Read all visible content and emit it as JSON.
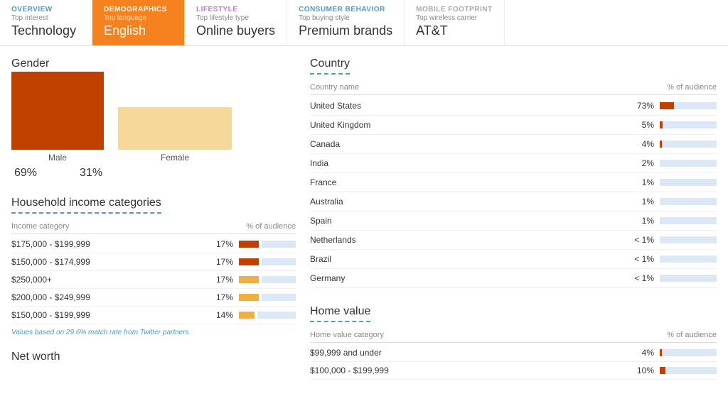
{
  "nav": {
    "tabs": [
      {
        "id": "overview",
        "label": "OVERVIEW",
        "subtitle": "Top interest",
        "value": "Technology",
        "active": false,
        "class": "overview"
      },
      {
        "id": "demographics",
        "label": "DEMOGRAPHICS",
        "subtitle": "Top language",
        "value": "English",
        "active": true,
        "class": "active"
      },
      {
        "id": "lifestyle",
        "label": "LIFESTYLE",
        "subtitle": "Top lifestyle type",
        "value": "Online buyers",
        "active": false,
        "class": "lifestyle"
      },
      {
        "id": "consumer",
        "label": "CONSUMER BEHAVIOR",
        "subtitle": "Top buying style",
        "value": "Premium brands",
        "active": false,
        "class": "consumer"
      },
      {
        "id": "mobile",
        "label": "MOBILE FOOTPRINT",
        "subtitle": "Top wireless carrier",
        "value": "AT&T",
        "active": false,
        "class": "mobile"
      }
    ]
  },
  "gender": {
    "title": "Gender",
    "male": {
      "label": "Male",
      "pct": "69%",
      "height": 110,
      "color": "#c04000"
    },
    "female": {
      "label": "Female",
      "pct": "31%",
      "height": 60,
      "color": "#f5d89a"
    }
  },
  "household_income": {
    "title": "Household income categories",
    "col1": "Income category",
    "col2": "% of audience",
    "rows": [
      {
        "label": "$175,000 - $199,999",
        "pct": "17%",
        "fill_width": 28,
        "fill_color": "#c04000"
      },
      {
        "label": "$150,000 - $174,999",
        "pct": "17%",
        "fill_width": 28,
        "fill_color": "#c04000"
      },
      {
        "label": "$250,000+",
        "pct": "17%",
        "fill_width": 28,
        "fill_color": "#f0b040"
      },
      {
        "label": "$200,000 - $249,999",
        "pct": "17%",
        "fill_width": 28,
        "fill_color": "#f0b040"
      },
      {
        "label": "$150,000 - $199,999",
        "pct": "14%",
        "fill_width": 22,
        "fill_color": "#f0b040"
      }
    ],
    "note": "Values based on 29.6% match rate from Twitter partners"
  },
  "net_worth": {
    "title": "Net worth"
  },
  "country": {
    "title": "Country",
    "col1": "Country name",
    "col2": "% of audience",
    "rows": [
      {
        "name": "United States",
        "pct": "73%",
        "fill_width": 55,
        "fill_color": "#c04000"
      },
      {
        "name": "United Kingdom",
        "pct": "5%",
        "fill_width": 4,
        "fill_color": "#c04000"
      },
      {
        "name": "Canada",
        "pct": "4%",
        "fill_width": 3,
        "fill_color": "#c04000"
      },
      {
        "name": "India",
        "pct": "2%",
        "fill_width": 0,
        "fill_color": "#c04000"
      },
      {
        "name": "France",
        "pct": "1%",
        "fill_width": 0,
        "fill_color": "#c04000"
      },
      {
        "name": "Australia",
        "pct": "1%",
        "fill_width": 0,
        "fill_color": "#c04000"
      },
      {
        "name": "Spain",
        "pct": "1%",
        "fill_width": 0,
        "fill_color": "#c04000"
      },
      {
        "name": "Netherlands",
        "pct": "< 1%",
        "fill_width": 0,
        "fill_color": "#c04000"
      },
      {
        "name": "Brazil",
        "pct": "< 1%",
        "fill_width": 0,
        "fill_color": "#c04000"
      },
      {
        "name": "Germany",
        "pct": "< 1%",
        "fill_width": 0,
        "fill_color": "#c04000"
      }
    ]
  },
  "home_value": {
    "title": "Home value",
    "col1": "Home value category",
    "col2": "% of audience",
    "rows": [
      {
        "label": "$99,999 and under",
        "pct": "4%",
        "fill_width": 3,
        "fill_color": "#c04000"
      },
      {
        "label": "$100,000 - $199,999",
        "pct": "10%",
        "fill_width": 8,
        "fill_color": "#c04000"
      }
    ]
  }
}
